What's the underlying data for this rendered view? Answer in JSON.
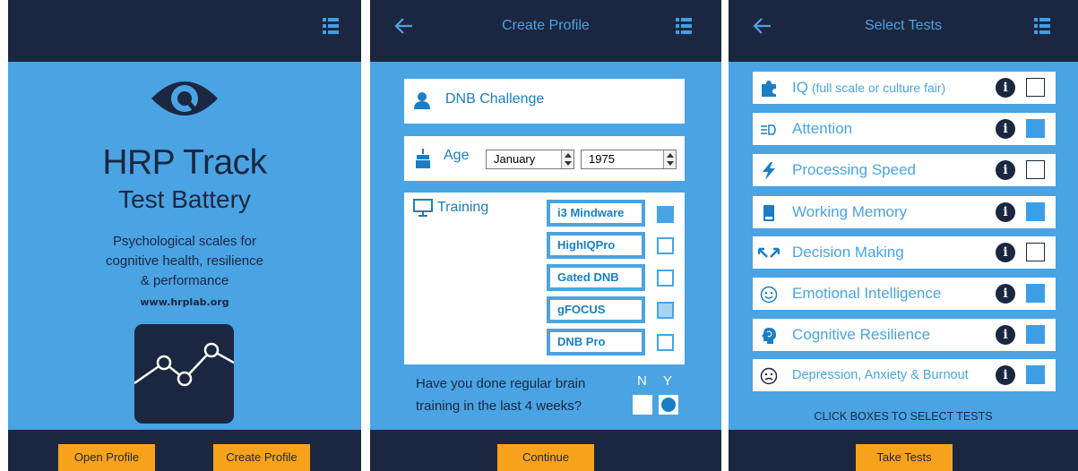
{
  "screen1": {
    "app_title": "HRP Track",
    "app_subtitle": "Test Battery",
    "tagline_lines": [
      "Psychological scales for",
      "cognitive health, resilience",
      "& performance"
    ],
    "url": "www.hrplab.org",
    "open_profile_label": "Open Profile",
    "create_profile_label": "Create Profile",
    "icons": [
      "menu-icon",
      "eye-logo",
      "line-chart-icon"
    ]
  },
  "screen2": {
    "title": "Create Profile",
    "name_value": "DNB Challenge",
    "age_label": "Age",
    "month_value": "January",
    "year_value": "1975",
    "training_label": "Training",
    "programs": [
      {
        "label": "i3 Mindware",
        "checked": true
      },
      {
        "label": "HighIQPro",
        "checked": false
      },
      {
        "label": "Gated DNB",
        "checked": false
      },
      {
        "label": "gFOCUS",
        "checked": "partial"
      },
      {
        "label": "DNB Pro",
        "checked": false
      }
    ],
    "question_line1": "Have you done regular brain",
    "question_line2": "training in the last 4 weeks?",
    "no_label": "N",
    "yes_label": "Y",
    "selected_answer": "Y",
    "continue_label": "Continue",
    "icons": [
      "back-arrow-icon",
      "menu-icon",
      "user-icon",
      "cake-icon",
      "monitor-icon"
    ]
  },
  "screen3": {
    "title": "Select Tests",
    "tests": [
      {
        "label": "IQ",
        "suffix": " (full scale or culture fair)",
        "icon": "puzzle-icon",
        "checked": false
      },
      {
        "label": "Attention",
        "suffix": "",
        "icon": "attention-icon",
        "checked": true
      },
      {
        "label": "Processing Speed",
        "suffix": "",
        "icon": "lightning-icon",
        "checked": false
      },
      {
        "label": "Working Memory",
        "suffix": "",
        "icon": "memory-card-icon",
        "checked": true
      },
      {
        "label": "Decision Making",
        "suffix": "",
        "icon": "arrows-icon",
        "checked": false
      },
      {
        "label": "Emotional Intelligence",
        "suffix": "",
        "icon": "smiley-icon",
        "checked": true
      },
      {
        "label": "Cognitive Resilience",
        "suffix": "",
        "icon": "brain-head-icon",
        "checked": true
      },
      {
        "label": "Depression, Anxiety & Burnout",
        "suffix": "",
        "icon": "sad-face-icon",
        "checked": true
      }
    ],
    "info_glyph": "i",
    "instruction": "CLICK BOXES TO SELECT TESTS",
    "take_tests_label": "Take Tests"
  },
  "colors": {
    "background_blue": "#4aa3e3",
    "navy": "#1b2740",
    "orange": "#f7a21b",
    "white": "#ffffff"
  }
}
